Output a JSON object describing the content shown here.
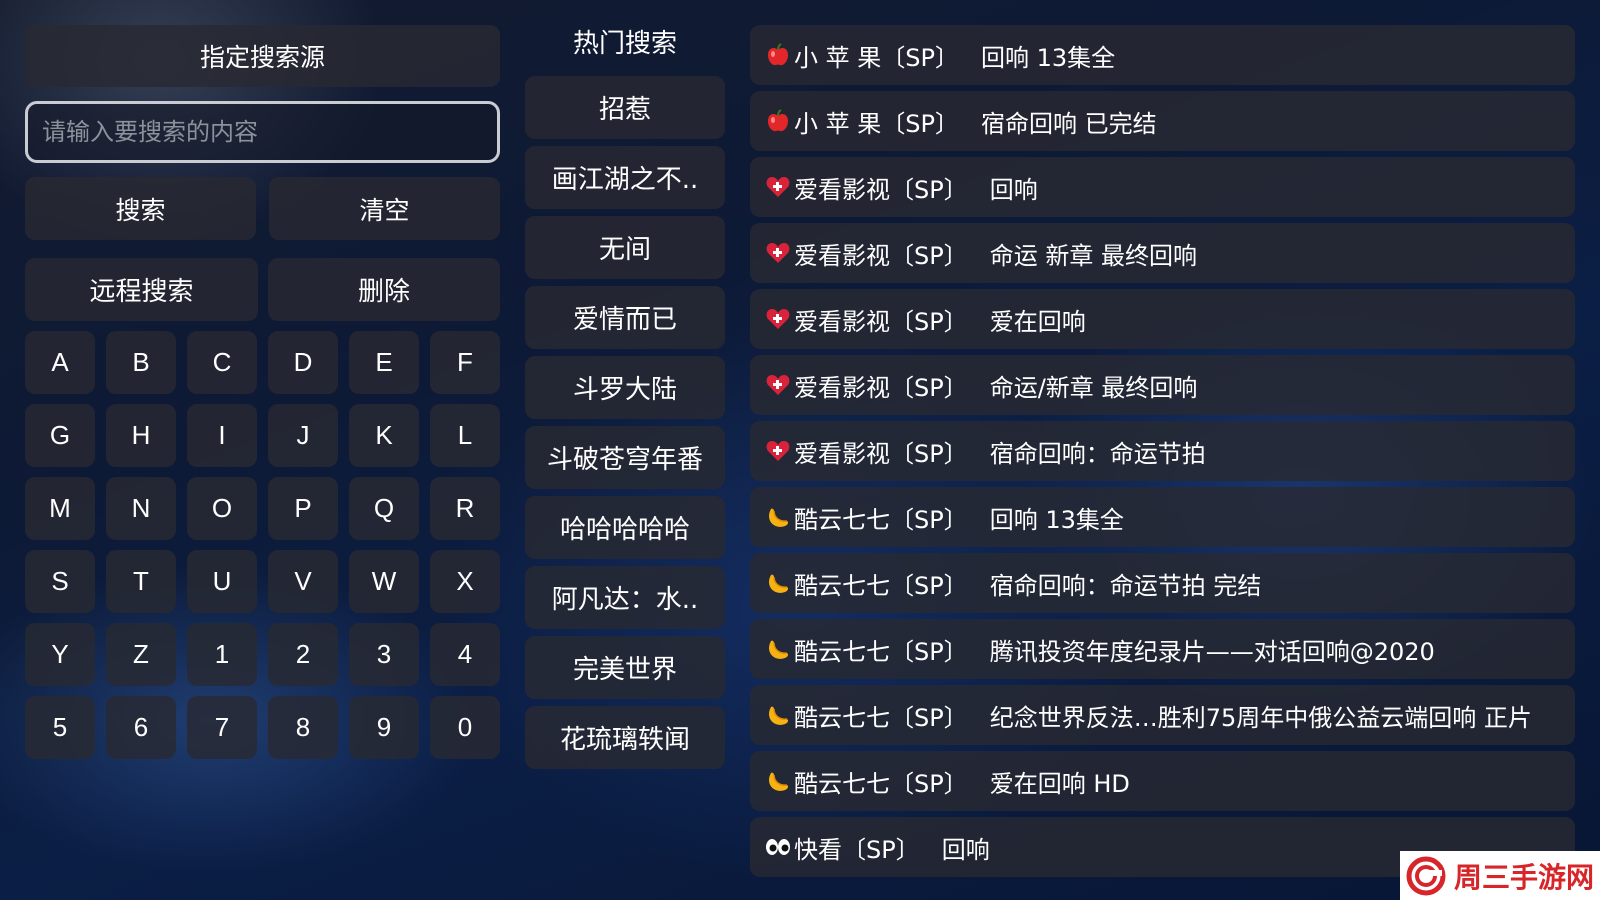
{
  "left_panel": {
    "source_button": "指定搜索源",
    "search_placeholder": "请输入要搜索的内容",
    "search_value": "",
    "search_button": "搜索",
    "clear_button": "清空",
    "remote_search_button": "远程搜索",
    "delete_button": "删除",
    "keys": [
      "A",
      "B",
      "C",
      "D",
      "E",
      "F",
      "G",
      "H",
      "I",
      "J",
      "K",
      "L",
      "M",
      "N",
      "O",
      "P",
      "Q",
      "R",
      "S",
      "T",
      "U",
      "V",
      "W",
      "X",
      "Y",
      "Z",
      "1",
      "2",
      "3",
      "4",
      "5",
      "6",
      "7",
      "8",
      "9",
      "0"
    ]
  },
  "hot_search": {
    "title": "热门搜索",
    "items": [
      "招惹",
      "画江湖之不..",
      "无间",
      "爱情而已",
      "斗罗大陆",
      "斗破苍穹年番",
      "哈哈哈哈哈",
      "阿凡达：水..",
      "完美世界",
      "花琉璃轶闻"
    ]
  },
  "results": [
    {
      "icon": "apple-icon",
      "source": "小 苹 果〔SP〕",
      "title": "回响 13集全"
    },
    {
      "icon": "apple-icon",
      "source": "小 苹 果〔SP〕",
      "title": "宿命回响 已完结"
    },
    {
      "icon": "heart-icon",
      "source": "爱看影视〔SP〕",
      "title": "回响"
    },
    {
      "icon": "heart-icon",
      "source": "爱看影视〔SP〕",
      "title": "命运 新章 最终回响"
    },
    {
      "icon": "heart-icon",
      "source": "爱看影视〔SP〕",
      "title": "爱在回响"
    },
    {
      "icon": "heart-icon",
      "source": "爱看影视〔SP〕",
      "title": "命运/新章 最终回响"
    },
    {
      "icon": "heart-icon",
      "source": "爱看影视〔SP〕",
      "title": "宿命回响：命运节拍"
    },
    {
      "icon": "moon-icon",
      "source": "酷云七七〔SP〕",
      "title": "回响 13集全"
    },
    {
      "icon": "moon-icon",
      "source": "酷云七七〔SP〕",
      "title": "宿命回响：命运节拍 完结"
    },
    {
      "icon": "moon-icon",
      "source": "酷云七七〔SP〕",
      "title": "腾讯投资年度纪录片——对话回响@2020"
    },
    {
      "icon": "moon-icon",
      "source": "酷云七七〔SP〕",
      "title": "纪念世界反法…胜利75周年中俄公益云端回响 正片"
    },
    {
      "icon": "moon-icon",
      "source": "酷云七七〔SP〕",
      "title": "爱在回响 HD"
    },
    {
      "icon": "eyes-icon",
      "source": "快看〔SP〕",
      "title": "回响"
    }
  ],
  "watermark": {
    "text": "周三手游网"
  },
  "colors": {
    "tile": "#2a2c34",
    "accent_red": "#d7262a",
    "border": "#c9ccd3"
  }
}
